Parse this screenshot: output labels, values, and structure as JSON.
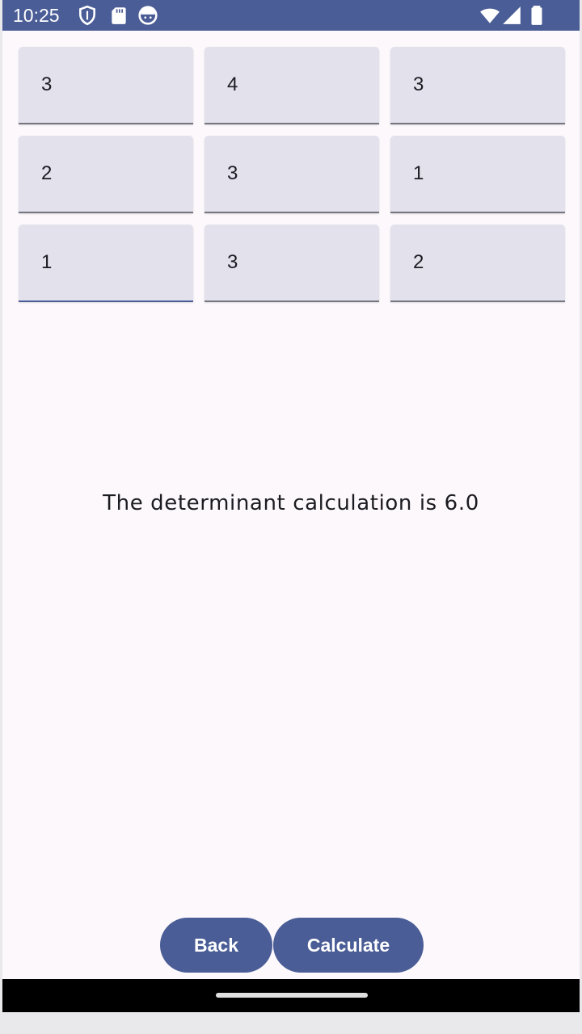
{
  "status_bar": {
    "time": "10:25",
    "left_icons": [
      "shield-icon",
      "sd-card-icon",
      "smiley-icon"
    ],
    "right_icons": [
      "wifi-icon",
      "signal-icon",
      "battery-icon"
    ],
    "background": "#4a5d96"
  },
  "matrix": {
    "rows": [
      [
        "3",
        "4",
        "3"
      ],
      [
        "2",
        "3",
        "1"
      ],
      [
        "1",
        "3",
        "2"
      ]
    ],
    "focused_cell": "row 3, column 1"
  },
  "result": {
    "text": "The determinant calculation is 6.0"
  },
  "buttons": {
    "back": "Back",
    "calculate": "Calculate"
  },
  "colors": {
    "primary": "#4a5d96",
    "field_background": "#e2e1ec",
    "screen_background": "#fcf8fc"
  }
}
